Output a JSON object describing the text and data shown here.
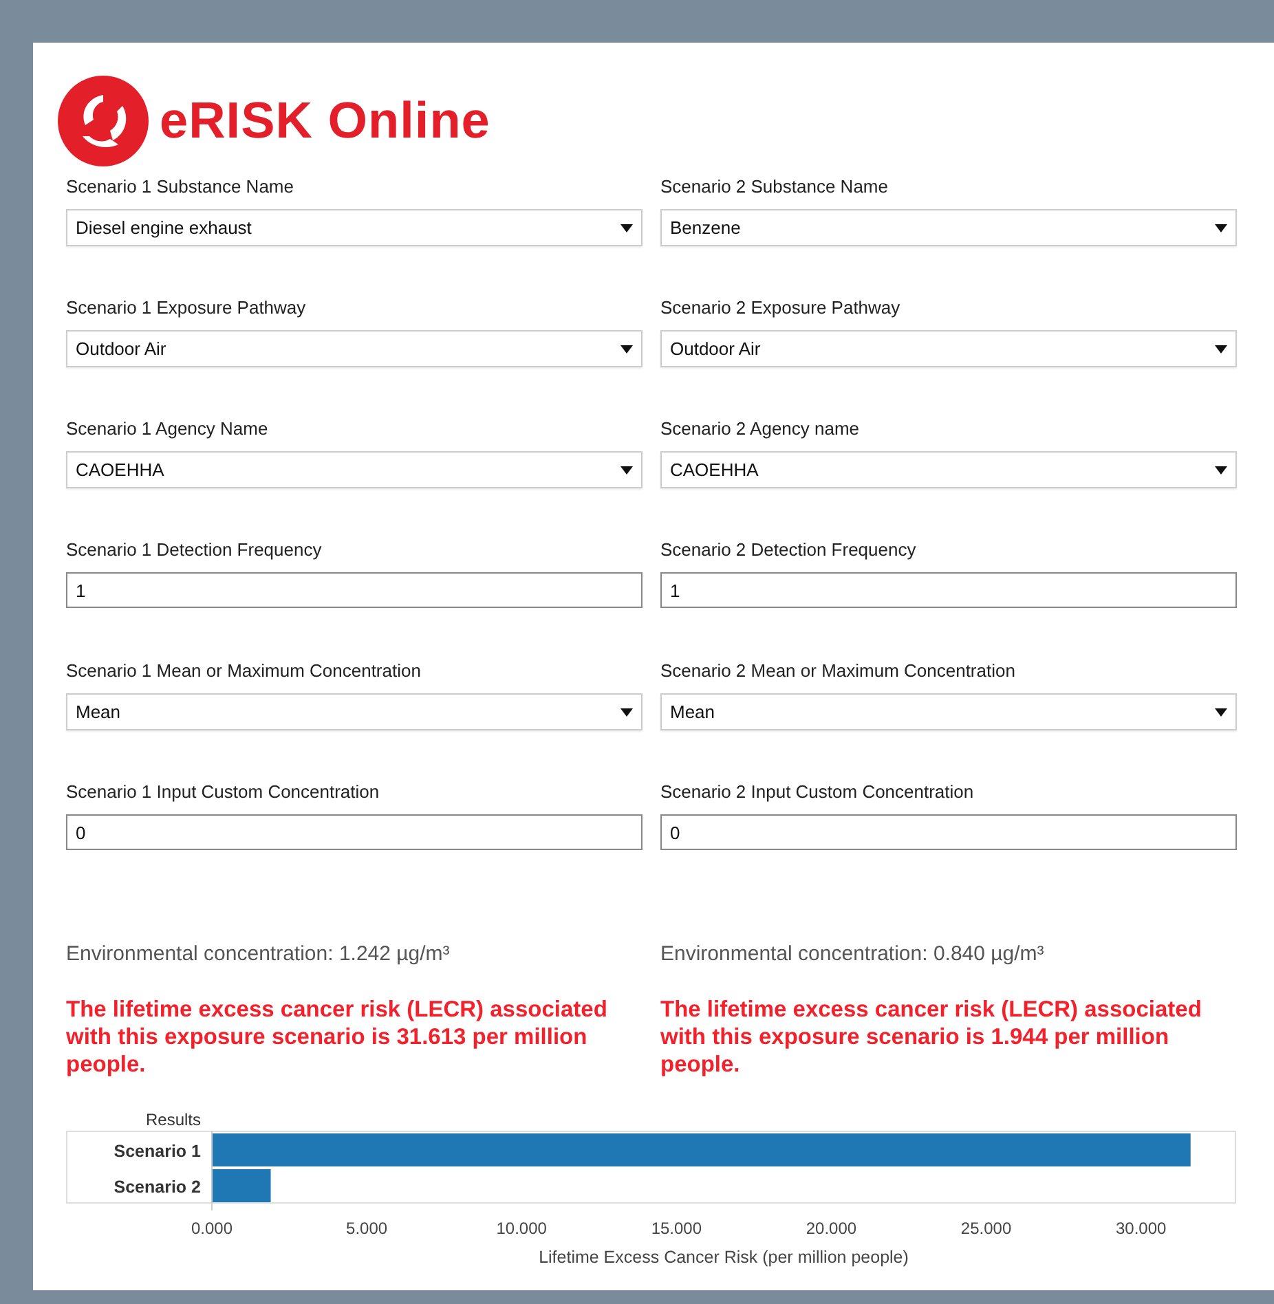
{
  "header": {
    "logo_text": "eRISK Online"
  },
  "scenarios": [
    {
      "fields": [
        {
          "kind": "select",
          "label": "Scenario 1 Substance Name",
          "value": "Diesel engine exhaust"
        },
        {
          "kind": "select",
          "label": "Scenario 1 Exposure Pathway",
          "value": "Outdoor Air"
        },
        {
          "kind": "select",
          "label": "Scenario 1 Agency Name",
          "value": "CAOEHHA"
        },
        {
          "kind": "text",
          "label": "Scenario 1 Detection Frequency",
          "value": "1"
        },
        {
          "kind": "select",
          "label": "Scenario 1 Mean or Maximum Concentration",
          "value": "Mean"
        },
        {
          "kind": "text",
          "label": "Scenario 1 Input Custom Concentration",
          "value": "0"
        }
      ],
      "concentration": "Environmental concentration: 1.242 µg/m³",
      "risk": "The lifetime excess cancer risk (LECR) associated with this exposure scenario is 31.613 per million people."
    },
    {
      "fields": [
        {
          "kind": "select",
          "label": "Scenario 2 Substance Name",
          "value": "Benzene"
        },
        {
          "kind": "select",
          "label": "Scenario 2 Exposure Pathway",
          "value": "Outdoor Air"
        },
        {
          "kind": "select",
          "label": "Scenario 2 Agency name",
          "value": "CAOEHHA"
        },
        {
          "kind": "text",
          "label": "Scenario 2 Detection Frequency",
          "value": "1"
        },
        {
          "kind": "select",
          "label": "Scenario 2 Mean or Maximum Concentration",
          "value": "Mean"
        },
        {
          "kind": "text",
          "label": "Scenario 2 Input Custom Concentration",
          "value": "0"
        }
      ],
      "concentration": "Environmental concentration: 0.840 µg/m³",
      "risk": "The lifetime excess cancer risk (LECR) associated with this exposure scenario is 1.944 per million people."
    }
  ],
  "results": {
    "chart_data": {
      "type": "bar",
      "orientation": "horizontal",
      "title": "Results",
      "xlabel": "Lifetime Excess Cancer Risk (per million people)",
      "categories": [
        "Scenario 1",
        "Scenario 2"
      ],
      "series": [
        {
          "color": "#1f77b4",
          "values": [
            31.6,
            1.9
          ]
        }
      ],
      "xlim": [
        0,
        33.05
      ],
      "xticks": [
        {
          "value": 0,
          "label": "0.000"
        },
        {
          "value": 5,
          "label": "5.000"
        },
        {
          "value": 10,
          "label": "10.000"
        },
        {
          "value": 15,
          "label": "15.000"
        },
        {
          "value": 20,
          "label": "20.000"
        },
        {
          "value": 25,
          "label": "25.000"
        },
        {
          "value": 30,
          "label": "30.000"
        }
      ]
    }
  }
}
